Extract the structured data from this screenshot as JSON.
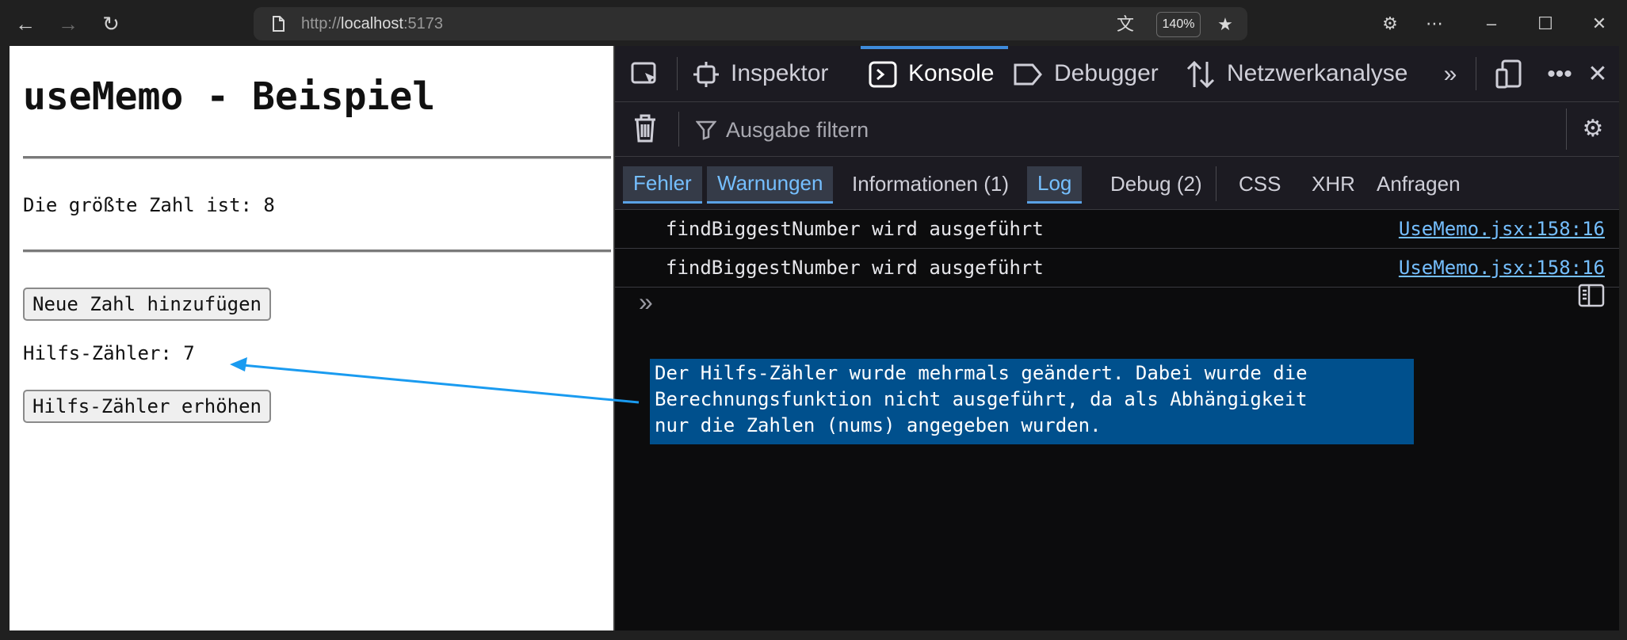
{
  "browser": {
    "url_scheme": "http://",
    "url_host": "localhost",
    "url_port": ":5173",
    "zoom": "140%"
  },
  "page": {
    "title": "useMemo - Beispiel",
    "biggest_text": "Die größte Zahl ist: 8",
    "add_button": "Neue Zahl hinzufügen",
    "helper_text": "Hilfs-Zähler: 7",
    "increment_button": "Hilfs-Zähler erhöhen"
  },
  "devtools": {
    "tabs": [
      {
        "label": "Inspektor"
      },
      {
        "label": "Konsole"
      },
      {
        "label": "Debugger"
      },
      {
        "label": "Netzwerkanalyse"
      }
    ],
    "filter_placeholder": "Ausgabe filtern",
    "levels": [
      {
        "label": "Fehler",
        "active": true
      },
      {
        "label": "Warnungen",
        "active": true
      },
      {
        "label": "Informationen (1)",
        "active": false
      },
      {
        "label": "Log",
        "active": true
      },
      {
        "label": "Debug (2)",
        "active": false
      },
      {
        "label": "CSS",
        "active": false
      },
      {
        "label": "XHR",
        "active": false
      },
      {
        "label": "Anfragen",
        "active": false
      }
    ],
    "messages": [
      {
        "text": "findBiggestNumber wird ausgeführt",
        "source": "UseMemo.jsx:158:16"
      },
      {
        "text": "findBiggestNumber wird ausgeführt",
        "source": "UseMemo.jsx:158:16"
      }
    ]
  },
  "annotation": {
    "lines": [
      "Der Hilfs-Zähler wurde mehrmals geändert. Dabei wurde die",
      "Berechnungsfunktion nicht ausgeführt, da als Abhängigkeit",
      "nur die Zahlen (nums) angegeben wurden."
    ],
    "color": "#00508d",
    "arrow_color": "#1a9bf0"
  }
}
